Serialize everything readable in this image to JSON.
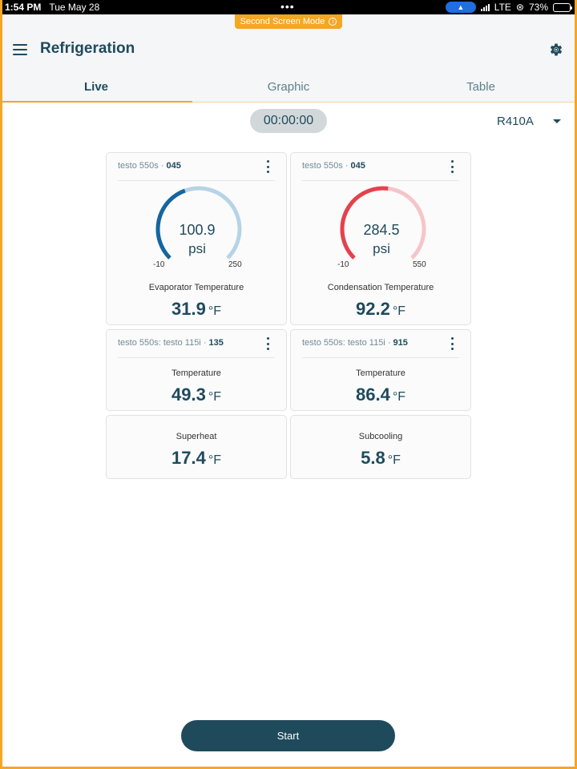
{
  "status_bar": {
    "time": "1:54 PM",
    "date": "Tue May 28",
    "network": "LTE",
    "battery": "73%"
  },
  "banner": {
    "label": "Second Screen Mode"
  },
  "header": {
    "title": "Refrigeration",
    "tabs": [
      {
        "label": "Live",
        "active": true
      },
      {
        "label": "Graphic",
        "active": false
      },
      {
        "label": "Table",
        "active": false
      }
    ]
  },
  "timer": {
    "value": "00:00:00"
  },
  "refrigerant": {
    "selected": "R410A"
  },
  "gauges": [
    {
      "device": "testo 550s",
      "device_id": "045",
      "value": "100.9",
      "unit": "psi",
      "min": "-10",
      "max": "250",
      "fraction": 0.427,
      "color": "#1565a0",
      "track_color": "#b7d3e6",
      "label": "Evaporator Temperature",
      "temp": "31.9",
      "temp_unit": "°F"
    },
    {
      "device": "testo 550s",
      "device_id": "045",
      "value": "284.5",
      "unit": "psi",
      "min": "-10",
      "max": "550",
      "fraction": 0.526,
      "color": "#e5414d",
      "track_color": "#f6c5c9",
      "label": "Condensation Temperature",
      "temp": "92.2",
      "temp_unit": "°F"
    }
  ],
  "probes": [
    {
      "device": "testo 550s: testo 115i",
      "device_id": "135",
      "label": "Temperature",
      "value": "49.3",
      "unit": "°F"
    },
    {
      "device": "testo 550s: testo 115i",
      "device_id": "915",
      "label": "Temperature",
      "value": "86.4",
      "unit": "°F"
    }
  ],
  "calculated": [
    {
      "label": "Superheat",
      "value": "17.4",
      "unit": "°F"
    },
    {
      "label": "Subcooling",
      "value": "5.8",
      "unit": "°F"
    }
  ],
  "start_button": {
    "label": "Start"
  }
}
